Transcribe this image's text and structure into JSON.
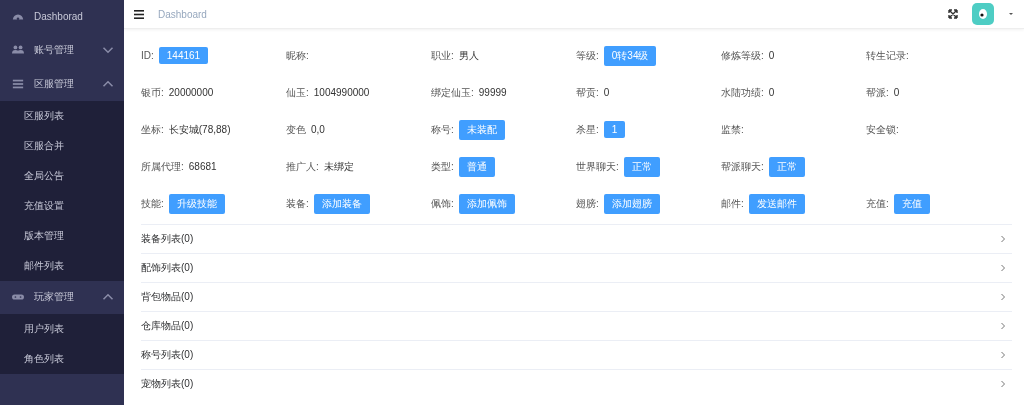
{
  "sidebar": {
    "items": [
      {
        "label": "Dashborad"
      },
      {
        "label": "账号管理",
        "expanded": false
      },
      {
        "label": "区服管理",
        "expanded": true,
        "children": [
          {
            "label": "区服列表"
          },
          {
            "label": "区服合并"
          },
          {
            "label": "全局公告"
          },
          {
            "label": "充值设置"
          },
          {
            "label": "版本管理"
          },
          {
            "label": "邮件列表"
          }
        ]
      },
      {
        "label": "玩家管理",
        "expanded": true,
        "children": [
          {
            "label": "用户列表"
          },
          {
            "label": "角色列表"
          }
        ]
      }
    ]
  },
  "header": {
    "breadcrumb": "Dashboard"
  },
  "info_rows": [
    [
      {
        "label": "ID:",
        "kind": "button",
        "value": "144161"
      },
      {
        "label": "昵称:"
      },
      {
        "label": "职业:",
        "kind": "text",
        "value": "男人"
      },
      {
        "label": "等级:",
        "kind": "button",
        "value": "0转34级"
      },
      {
        "label": "修炼等级:",
        "kind": "text",
        "value": "0"
      },
      {
        "label": "转生记录:"
      }
    ],
    [
      {
        "label": "银币:",
        "kind": "text",
        "value": "20000000"
      },
      {
        "label": "仙玉:",
        "kind": "text",
        "value": "1004990000"
      },
      {
        "label": "绑定仙玉:",
        "kind": "text",
        "value": "99999"
      },
      {
        "label": "帮贡:",
        "kind": "text",
        "value": "0"
      },
      {
        "label": "水陆功绩:",
        "kind": "text",
        "value": "0"
      },
      {
        "label": "帮派:",
        "kind": "text",
        "value": "0"
      }
    ],
    [
      {
        "label": "坐标:",
        "kind": "text",
        "value": "长安城(78,88)"
      },
      {
        "label": "变色",
        "kind": "text",
        "value": "0,0"
      },
      {
        "label": "称号:",
        "kind": "button",
        "value": "未装配"
      },
      {
        "label": "杀星:",
        "kind": "button",
        "value": "1"
      },
      {
        "label": "监禁:"
      },
      {
        "label": "安全锁:"
      }
    ],
    [
      {
        "label": "所属代理:",
        "kind": "text",
        "value": "68681"
      },
      {
        "label": "推广人:",
        "kind": "text",
        "value": "未绑定"
      },
      {
        "label": "类型:",
        "kind": "button",
        "value": "普通"
      },
      {
        "label": "世界聊天:",
        "kind": "button",
        "value": "正常"
      },
      {
        "label": "帮派聊天:",
        "kind": "button",
        "value": "正常"
      }
    ],
    [
      {
        "label": "技能:",
        "kind": "button",
        "value": "升级技能"
      },
      {
        "label": "装备:",
        "kind": "button",
        "value": "添加装备"
      },
      {
        "label": "佩饰:",
        "kind": "button",
        "value": "添加佩饰"
      },
      {
        "label": "翅膀:",
        "kind": "button",
        "value": "添加翅膀"
      },
      {
        "label": "邮件:",
        "kind": "button",
        "value": "发送邮件"
      },
      {
        "label": "充值:",
        "kind": "button",
        "value": "充值"
      }
    ]
  ],
  "collapse_list": [
    {
      "label": "装备列表(0)"
    },
    {
      "label": "配饰列表(0)"
    },
    {
      "label": "背包物品(0)"
    },
    {
      "label": "仓库物品(0)"
    },
    {
      "label": "称号列表(0)"
    },
    {
      "label": "宠物列表(0)"
    }
  ]
}
